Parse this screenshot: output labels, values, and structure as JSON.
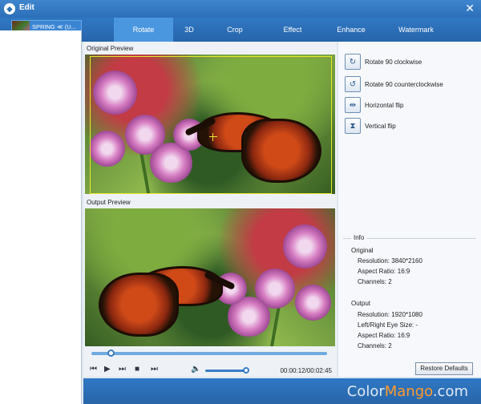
{
  "window": {
    "title": "Edit",
    "logo_glyph": "◆"
  },
  "file": {
    "name": "SPRING ≪ (U..."
  },
  "tabs": [
    {
      "label": "Rotate",
      "active": true
    },
    {
      "label": "3D",
      "active": false
    },
    {
      "label": "Crop",
      "active": false
    },
    {
      "label": "Effect",
      "active": false
    },
    {
      "label": "Enhance",
      "active": false
    },
    {
      "label": "Watermark",
      "active": false
    }
  ],
  "preview": {
    "original_label": "Original Preview",
    "output_label": "Output Preview"
  },
  "player": {
    "time": "00:00:12/00:02:45",
    "progress_fraction": 0.08,
    "volume_fraction": 1.0
  },
  "options": {
    "rotate_cw": "Rotate 90 clockwise",
    "rotate_ccw": "Rotate 90 counterclockwise",
    "hflip": "Horizontal flip",
    "vflip": "Vertical flip"
  },
  "info": {
    "heading": "Info",
    "original_heading": "Original",
    "orig_resolution": "Resolution: 3840*2160",
    "orig_aspect": "Aspect Ratio: 16:9",
    "orig_channels": "Channels: 2",
    "output_heading": "Output",
    "out_resolution": "Resolution: 1920*1080",
    "out_eye": "Left/Right Eye Size: -",
    "out_aspect": "Aspect Ratio: 16:9",
    "out_channels": "Channels: 2"
  },
  "buttons": {
    "restore": "Restore Defaults"
  },
  "watermark": {
    "part1": "Color",
    "part2": "Mango",
    "part3": ".com"
  },
  "colors": {
    "titlebar": "#2c6fb8",
    "active_tab": "#4b97df",
    "accent": "#3a7cc3"
  }
}
